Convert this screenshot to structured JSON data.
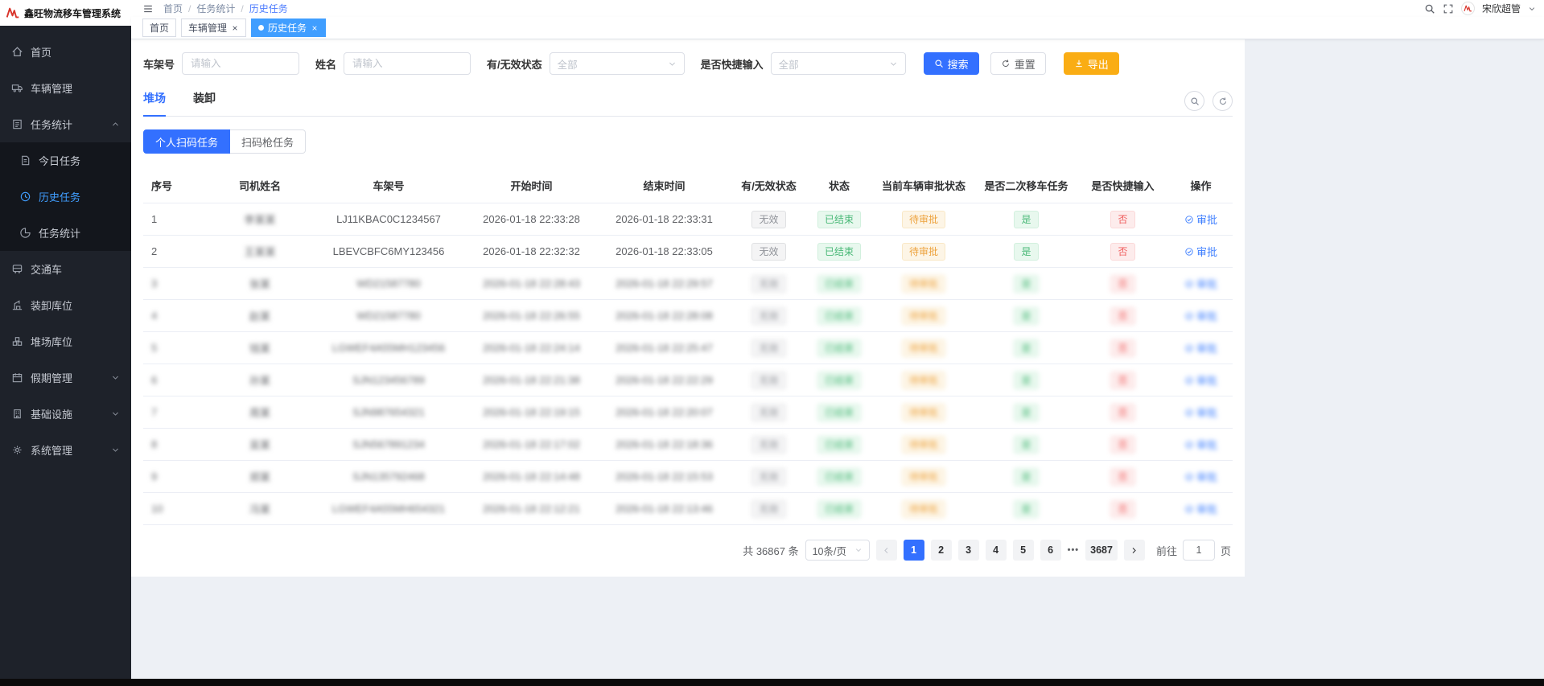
{
  "app": {
    "title": "鑫旺物流移车管理系统"
  },
  "theme": {
    "primary": "#3370ff",
    "tag_active": "#409eff",
    "warning": "#faad14",
    "success": "#49b877",
    "danger": "#f05b5b",
    "pending": "#eda23c",
    "sidebar_bg": "#1e222a",
    "submenu_bg": "#13161c"
  },
  "navbar": {
    "breadcrumb": [
      "首页",
      "任务统计",
      "历史任务"
    ],
    "username": "宋欣超管"
  },
  "tags_view": [
    {
      "key": "home",
      "label": "首页",
      "active": false,
      "closable": false,
      "dot": false
    },
    {
      "key": "vehicle-management",
      "label": "车辆管理",
      "active": false,
      "closable": true,
      "dot": false
    },
    {
      "key": "history-tasks",
      "label": "历史任务",
      "active": true,
      "closable": true,
      "dot": true
    }
  ],
  "sidebar": {
    "items": [
      {
        "key": "home",
        "label": "首页",
        "icon": "home-icon"
      },
      {
        "key": "vehicle-management",
        "label": "车辆管理",
        "icon": "truck-icon"
      },
      {
        "key": "task-statistics",
        "label": "任务统计",
        "icon": "clipboard-icon",
        "arrow": "up",
        "children": [
          {
            "key": "today-tasks",
            "label": "今日任务",
            "icon": "doc-icon"
          },
          {
            "key": "history-tasks",
            "label": "历史任务",
            "icon": "history-icon",
            "active": true
          },
          {
            "key": "task-stats",
            "label": "任务统计",
            "icon": "pie-icon"
          }
        ]
      },
      {
        "key": "shuttle-bus",
        "label": "交通车",
        "icon": "bus-icon"
      },
      {
        "key": "loading-bays",
        "label": "装卸库位",
        "icon": "crane-icon"
      },
      {
        "key": "yard-bays",
        "label": "堆场库位",
        "icon": "yard-icon"
      },
      {
        "key": "holiday-management",
        "label": "假期管理",
        "icon": "calendar-icon",
        "arrow": "down"
      },
      {
        "key": "infrastructure",
        "label": "基础设施",
        "icon": "building-icon",
        "arrow": "down"
      },
      {
        "key": "system-management",
        "label": "系统管理",
        "icon": "gear-icon",
        "arrow": "down"
      }
    ]
  },
  "filters": {
    "vin_label": "车架号",
    "vin_placeholder": "请输入",
    "name_label": "姓名",
    "name_placeholder": "请输入",
    "valid_label": "有/无效状态",
    "valid_value": "全部",
    "quick_label": "是否快捷输入",
    "quick_value": "全部",
    "search": "搜索",
    "reset": "重置",
    "export": "导出"
  },
  "tabs": [
    {
      "key": "yard",
      "label": "堆场",
      "active": true
    },
    {
      "key": "loading",
      "label": "装卸",
      "active": false
    }
  ],
  "segments": [
    {
      "key": "personal-scan-tasks",
      "label": "个人扫码任务",
      "active": true
    },
    {
      "key": "scan-gun-tasks",
      "label": "扫码枪任务",
      "active": false
    }
  ],
  "table": {
    "columns": [
      "序号",
      "司机姓名",
      "车架号",
      "开始时间",
      "结束时间",
      "有/无效状态",
      "状态",
      "当前车辆审批状态",
      "是否二次移车任务",
      "是否快捷输入",
      "操作"
    ],
    "rows": [
      {
        "seq": "1",
        "driver": "李某某",
        "vin": "LJ11KBAC0C1234567",
        "start": "2026-01-18 22:33:28",
        "end": "2026-01-18 22:33:31",
        "valid": "无效",
        "status": "已结束",
        "approval": "待审批",
        "second": "是",
        "quick": "否",
        "action": "审批",
        "masked": false
      },
      {
        "seq": "2",
        "driver": "王某某",
        "vin": "LBEVCBFC6MY123456",
        "start": "2026-01-18 22:32:32",
        "end": "2026-01-18 22:33:05",
        "valid": "无效",
        "status": "已结束",
        "approval": "待审批",
        "second": "是",
        "quick": "否",
        "action": "审批",
        "masked": false
      },
      {
        "seq": "3",
        "driver": "张某",
        "vin": "WD21587780",
        "start": "2026-01-18 22:28:43",
        "end": "2026-01-18 22:29:57",
        "valid": "无效",
        "status": "已结束",
        "approval": "待审批",
        "second": "是",
        "quick": "否",
        "action": "审批",
        "masked": true
      },
      {
        "seq": "4",
        "driver": "赵某",
        "vin": "WD21587780",
        "start": "2026-01-18 22:26:55",
        "end": "2026-01-18 22:28:08",
        "valid": "无效",
        "status": "已结束",
        "approval": "待审批",
        "second": "是",
        "quick": "否",
        "action": "审批",
        "masked": true
      },
      {
        "seq": "5",
        "driver": "钱某",
        "vin": "LGWEF4A55MH123456",
        "start": "2026-01-18 22:24:14",
        "end": "2026-01-18 22:25:47",
        "valid": "无效",
        "status": "已结束",
        "approval": "待审批",
        "second": "是",
        "quick": "否",
        "action": "审批",
        "masked": true
      },
      {
        "seq": "6",
        "driver": "孙某",
        "vin": "SJN123456789",
        "start": "2026-01-18 22:21:38",
        "end": "2026-01-18 22:22:29",
        "valid": "无效",
        "status": "已结束",
        "approval": "待审批",
        "second": "是",
        "quick": "否",
        "action": "审批",
        "masked": true
      },
      {
        "seq": "7",
        "driver": "周某",
        "vin": "SJN987654321",
        "start": "2026-01-18 22:19:15",
        "end": "2026-01-18 22:20:07",
        "valid": "无效",
        "status": "已结束",
        "approval": "待审批",
        "second": "是",
        "quick": "否",
        "action": "审批",
        "masked": true
      },
      {
        "seq": "8",
        "driver": "吴某",
        "vin": "SJN567891234",
        "start": "2026-01-18 22:17:02",
        "end": "2026-01-18 22:18:36",
        "valid": "无效",
        "status": "已结束",
        "approval": "待审批",
        "second": "是",
        "quick": "否",
        "action": "审批",
        "masked": true
      },
      {
        "seq": "9",
        "driver": "郑某",
        "vin": "SJN135792468",
        "start": "2026-01-18 22:14:48",
        "end": "2026-01-18 22:15:53",
        "valid": "无效",
        "status": "已结束",
        "approval": "待审批",
        "second": "是",
        "quick": "否",
        "action": "审批",
        "masked": true
      },
      {
        "seq": "10",
        "driver": "冯某",
        "vin": "LGWEF4A55MH654321",
        "start": "2026-01-18 22:12:21",
        "end": "2026-01-18 22:13:46",
        "valid": "无效",
        "status": "已结束",
        "approval": "待审批",
        "second": "是",
        "quick": "否",
        "action": "审批",
        "masked": true
      }
    ]
  },
  "pagination": {
    "total": "共 36867 条",
    "page_size": "10条/页",
    "pages": [
      "1",
      "2",
      "3",
      "4",
      "5",
      "6",
      "...",
      "3687"
    ],
    "active_page": "1",
    "goto_label": "前往",
    "goto_value": "1",
    "goto_unit": "页"
  }
}
